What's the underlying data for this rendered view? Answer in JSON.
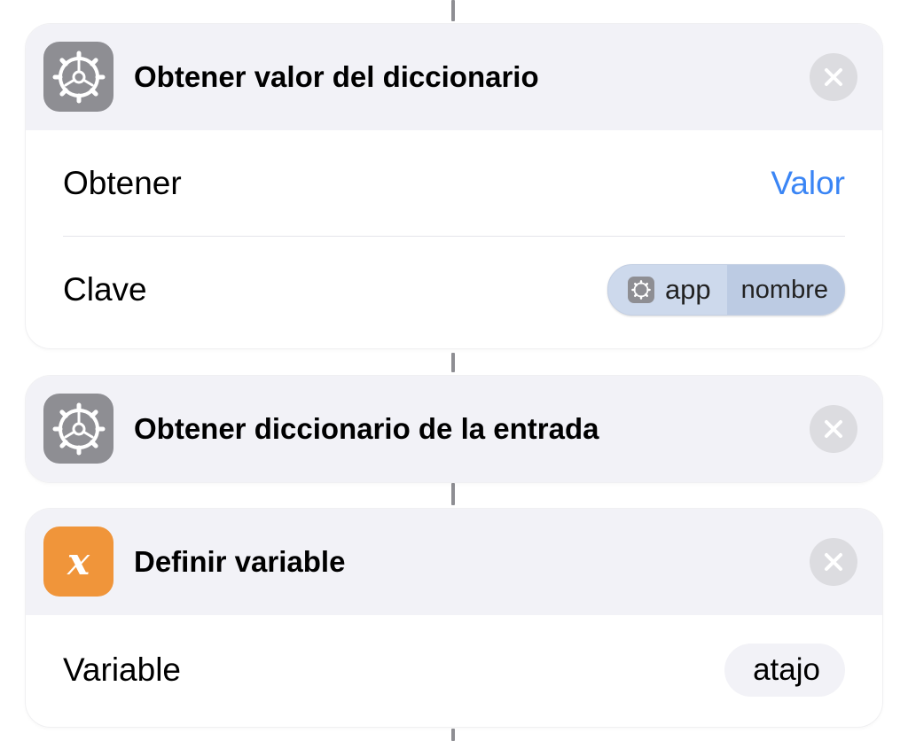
{
  "actions": [
    {
      "title": "Obtener valor del diccionario",
      "icon": "gear-icon",
      "params": [
        {
          "label": "Obtener",
          "value": "Valor"
        },
        {
          "label": "Clave",
          "token_main": "app",
          "token_property": "nombre"
        }
      ]
    },
    {
      "title": "Obtener diccionario de la entrada",
      "icon": "gear-icon"
    },
    {
      "title": "Definir variable",
      "icon": "variable-icon",
      "icon_glyph": "x",
      "params": [
        {
          "label": "Variable",
          "value": "atajo"
        }
      ]
    }
  ],
  "colors": {
    "link": "#3a85f5",
    "header_bg": "#f2f2f7",
    "settings_icon": "#8e8e93",
    "variable_icon": "#f0953a"
  }
}
